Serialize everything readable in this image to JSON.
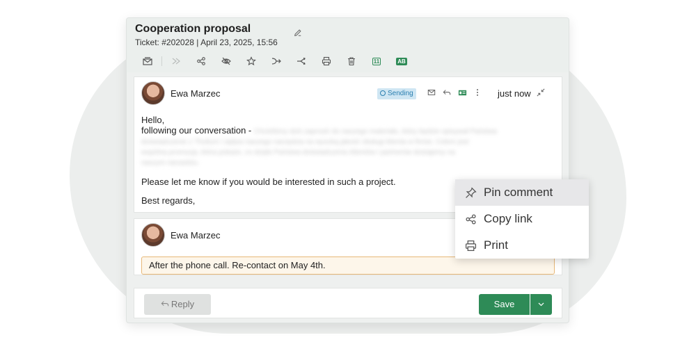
{
  "ticket": {
    "title": "Cooperation proposal",
    "subtitle": "Ticket: #202028 | April 23, 2025, 15:56"
  },
  "toolbar": {
    "icons": [
      "mail-stack-icon",
      "forward-icon",
      "share-icon",
      "hide-icon",
      "star-icon",
      "merge-icon",
      "split-icon",
      "print-icon",
      "trash-icon",
      "calendar-icon",
      "contact-card-icon"
    ],
    "calendar_label": "11",
    "card_label": "AB"
  },
  "message": {
    "author": "Ewa Marzec",
    "status": "Sending",
    "time": "just now",
    "greeting": "Hello,",
    "intro": "following our conversation -",
    "blurred_inline": "Chcieliśmy dziś zaprosić do naszego materiału, który będzie opisywał Państwa",
    "blurred_lines": [
      "doświadczenie z Thulium i wpływ naszego narzędzia na wysoką jakość obsługi klienta w firmie. Celem jest",
      "wspólna promocja, która pokaże, co dzięki Państwa doświadczeniu klientów i partnerów dostajemy na",
      "naszym narzędziu."
    ],
    "question": "Please let me know if you would be interested in such a project.",
    "closing": "Best regards,"
  },
  "comment": {
    "author": "Ewa Marzec",
    "note": "After the phone call. Re-contact on May 4th."
  },
  "footer": {
    "reply_label": "Reply",
    "save_label": "Save"
  },
  "context_menu": {
    "items": [
      {
        "label": "Pin comment",
        "icon": "pin-icon"
      },
      {
        "label": "Copy link",
        "icon": "share-link-icon"
      },
      {
        "label": "Print",
        "icon": "print-icon"
      }
    ]
  },
  "colors": {
    "accent_green": "#2e8b57",
    "status_blue": "#2a7fb0",
    "note_border": "#e7b878"
  }
}
